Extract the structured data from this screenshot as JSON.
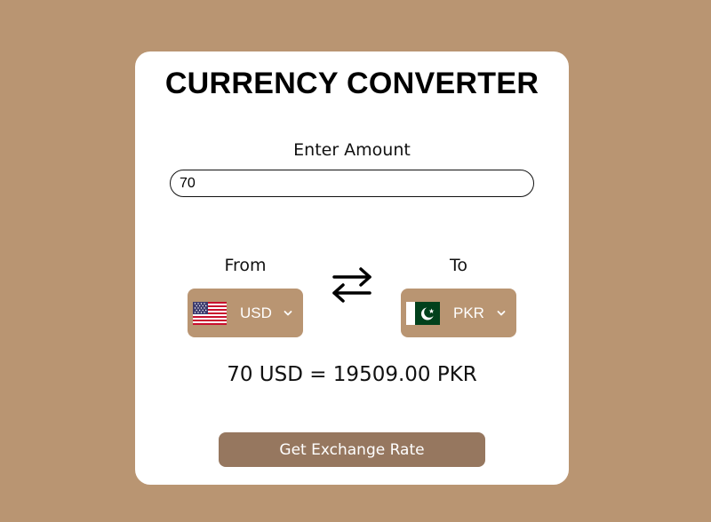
{
  "header": {
    "title": "CURRENCY CONVERTER"
  },
  "amount": {
    "label": "Enter Amount",
    "value": "70"
  },
  "from": {
    "label": "From",
    "currency": "USD",
    "flag": "us-flag-icon"
  },
  "to": {
    "label": "To",
    "currency": "PKR",
    "flag": "pk-flag-icon"
  },
  "swap": {
    "icon": "swap-arrows-icon"
  },
  "result": {
    "text": "70 USD = 19509.00 PKR"
  },
  "button": {
    "label": "Get Exchange Rate"
  },
  "colors": {
    "background": "#b99572",
    "card": "#ffffff",
    "select_bg": "#b99572",
    "button_bg": "#96775f",
    "text": "#111111"
  }
}
